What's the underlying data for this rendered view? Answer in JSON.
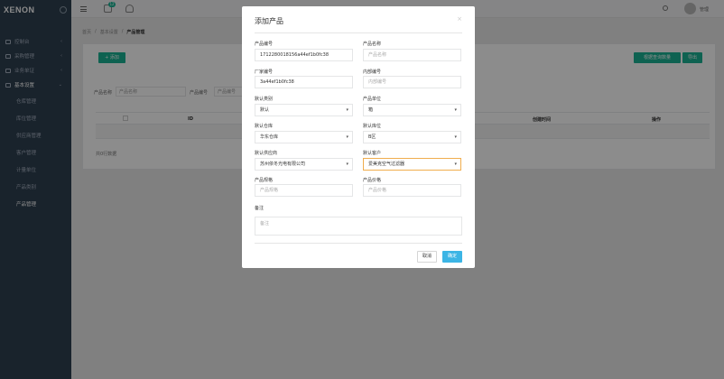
{
  "app": {
    "logo": "XENON"
  },
  "sidebar": {
    "items": [
      {
        "label": "控制台"
      },
      {
        "label": "采购管理"
      },
      {
        "label": "业务单证"
      },
      {
        "label": "基本设置"
      }
    ],
    "sub_items": [
      {
        "label": "仓库管理"
      },
      {
        "label": "库位管理"
      },
      {
        "label": "供应商管理"
      },
      {
        "label": "客户管理"
      },
      {
        "label": "计量单位"
      },
      {
        "label": "产品类别"
      },
      {
        "label": "产品管理"
      }
    ]
  },
  "topbar": {
    "badge1": "12",
    "badge2": "",
    "user": "管理"
  },
  "breadcrumb": {
    "home": "首页",
    "section": "基本设置",
    "current": "产品管理"
  },
  "page": {
    "add_button": "+ 添加",
    "right_button_1": "根据查询数量",
    "right_button_2": "导出",
    "filter_name_label": "产品名称",
    "filter_name_placeholder": "产品名称",
    "filter_code_label": "产品编号",
    "filter_code_placeholder": "产品编号",
    "table_headers": [
      "ID",
      "创建时间",
      "操作"
    ],
    "no_data": "共0行数据"
  },
  "modal": {
    "title": "添加产品",
    "close": "×",
    "fields": {
      "product_code": {
        "label": "产品编号",
        "value": "1712280018156a44ef1b0fc38"
      },
      "product_name": {
        "label": "产品名称",
        "placeholder": "产品名称"
      },
      "factory_code": {
        "label": "厂家编号",
        "value": "3a44ef1b0fc38"
      },
      "internal_code": {
        "label": "内部编号",
        "placeholder": "内部编号"
      },
      "default_category": {
        "label": "默认类别",
        "value": "默认"
      },
      "product_unit": {
        "label": "产品单位",
        "value": "箱"
      },
      "default_warehouse": {
        "label": "默认仓库",
        "value": "华东仓库"
      },
      "default_location": {
        "label": "默认库位",
        "value": "B区"
      },
      "default_supplier": {
        "label": "默认供应商",
        "value": "苏州依冬光电有限公司"
      },
      "default_customer": {
        "label": "默认客户",
        "value": "爱美克空气过滤器"
      },
      "product_spec": {
        "label": "产品规格",
        "placeholder": "产品规格"
      },
      "product_price": {
        "label": "产品价格",
        "placeholder": "产品价格"
      },
      "remark": {
        "label": "备注",
        "placeholder": "备注"
      }
    },
    "cancel": "取消",
    "confirm": "确定"
  }
}
